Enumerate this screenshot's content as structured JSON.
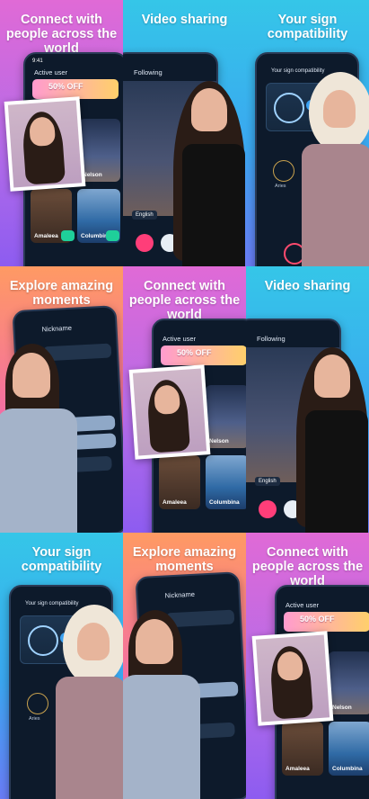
{
  "tiles": [
    {
      "headline": "Connect with people across the world",
      "theme": "pink",
      "screen_title": "Active user",
      "offer": "50% OFF",
      "cards": [
        "Nelson",
        "Amaleea",
        "Columbina"
      ]
    },
    {
      "headline": "Video sharing",
      "theme": "cyan",
      "screen_title": "Following",
      "lang": "English"
    },
    {
      "headline": "Your sign compatibility",
      "theme": "cyan",
      "screen_title": "Your sign compatibility",
      "sign": "Aries"
    },
    {
      "headline": "Explore amazing moments",
      "theme": "orange",
      "screen_title": "Nickname"
    },
    {
      "headline": "Connect with people across the world",
      "theme": "pink",
      "screen_title": "Active user",
      "offer": "50% OFF",
      "cards": [
        "Nelson",
        "Amaleea",
        "Columbina"
      ]
    },
    {
      "headline": "Video sharing",
      "theme": "cyan",
      "screen_title": "Following",
      "lang": "English"
    },
    {
      "headline": "Your sign compatibility",
      "theme": "cyan",
      "screen_title": "Your sign compatibility",
      "sign": "Aries"
    },
    {
      "headline": "Explore amazing moments",
      "theme": "orange",
      "screen_title": "Nickname"
    },
    {
      "headline": "Connect with people across the world",
      "theme": "pink",
      "screen_title": "Active user",
      "offer": "50% OFF",
      "cards": [
        "Nelson",
        "Amaleea",
        "Columbina"
      ]
    }
  ],
  "status_time": "9:41"
}
